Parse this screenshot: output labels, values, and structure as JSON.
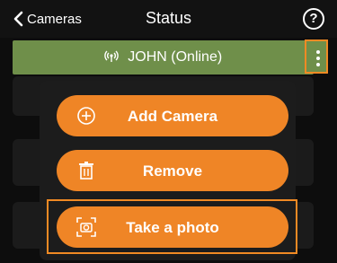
{
  "header": {
    "back_label": "Cameras",
    "title": "Status",
    "help_glyph": "?"
  },
  "device": {
    "name_status": "JOHN (Online)",
    "signal_icon": "wifi-signal-icon",
    "menu_icon": "more-vertical-icon"
  },
  "popup": {
    "actions": [
      {
        "label": "Add Camera",
        "icon": "plus-circle-icon"
      },
      {
        "label": "Remove",
        "icon": "trash-icon"
      },
      {
        "label": "Take a photo",
        "icon": "camera-capture-icon"
      }
    ]
  },
  "colors": {
    "accent": "#ef8526",
    "device_bar": "#6f8f4a",
    "background": "#0d0d0d"
  }
}
